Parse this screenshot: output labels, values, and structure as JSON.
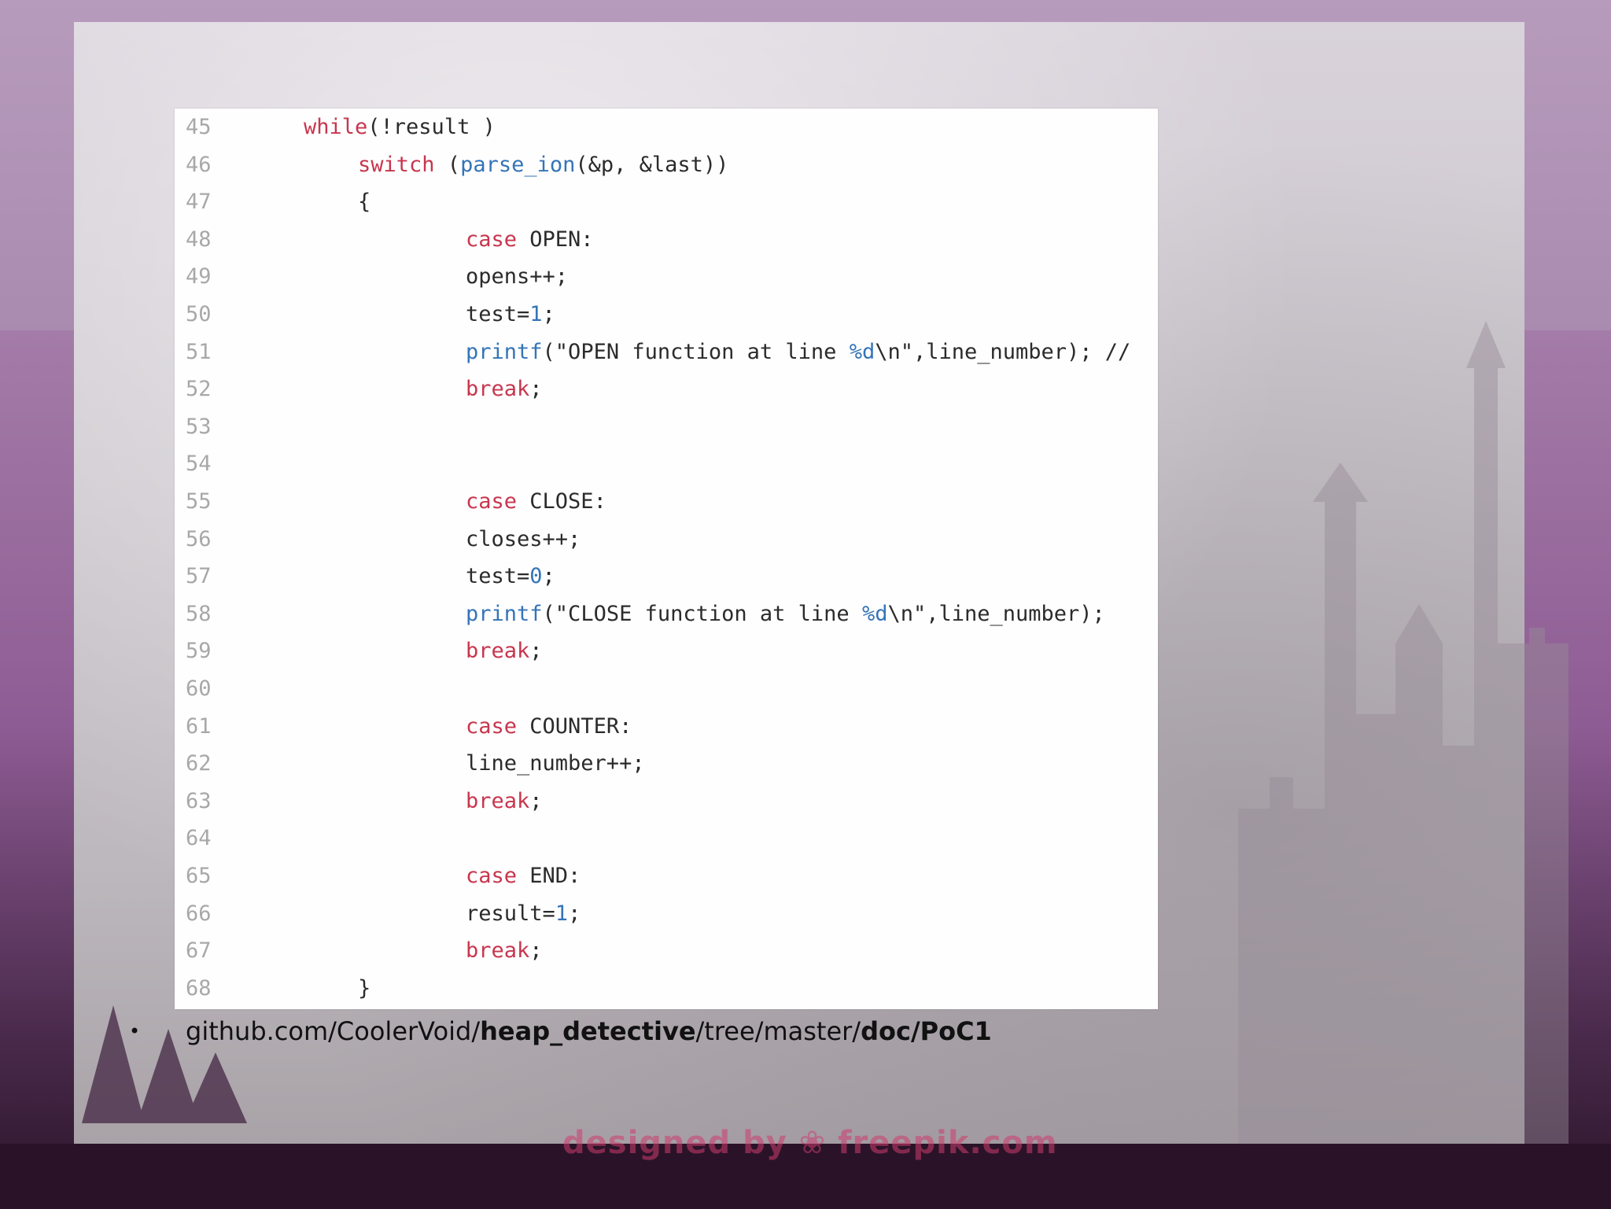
{
  "code": {
    "lines": [
      {
        "n": "45",
        "indent": 0,
        "parts": [
          {
            "t": "while",
            "c": "kw"
          },
          {
            "t": "(!result )",
            "c": ""
          }
        ]
      },
      {
        "n": "46",
        "indent": 1,
        "parts": [
          {
            "t": "switch",
            "c": "kw"
          },
          {
            "t": " (",
            "c": ""
          },
          {
            "t": "parse_ion",
            "c": "fn"
          },
          {
            "t": "(&p, &last))",
            "c": ""
          }
        ]
      },
      {
        "n": "47",
        "indent": 1,
        "parts": [
          {
            "t": "{",
            "c": ""
          }
        ]
      },
      {
        "n": "48",
        "indent": 2,
        "parts": [
          {
            "t": "case",
            "c": "kw"
          },
          {
            "t": " OPEN:",
            "c": ""
          }
        ]
      },
      {
        "n": "49",
        "indent": 2,
        "parts": [
          {
            "t": "opens++;",
            "c": ""
          }
        ]
      },
      {
        "n": "50",
        "indent": 2,
        "parts": [
          {
            "t": "test=",
            "c": ""
          },
          {
            "t": "1",
            "c": "num"
          },
          {
            "t": ";",
            "c": ""
          }
        ]
      },
      {
        "n": "51",
        "indent": 2,
        "parts": [
          {
            "t": "printf",
            "c": "fn"
          },
          {
            "t": "(\"OPEN function at line ",
            "c": ""
          },
          {
            "t": "%d",
            "c": "num"
          },
          {
            "t": "\\n\",line_number); //",
            "c": ""
          }
        ]
      },
      {
        "n": "52",
        "indent": 2,
        "parts": [
          {
            "t": "break",
            "c": "kw"
          },
          {
            "t": ";",
            "c": ""
          }
        ]
      },
      {
        "n": "53",
        "indent": 2,
        "parts": []
      },
      {
        "n": "54",
        "indent": 2,
        "parts": []
      },
      {
        "n": "55",
        "indent": 2,
        "parts": [
          {
            "t": "case",
            "c": "kw"
          },
          {
            "t": " CLOSE:",
            "c": ""
          }
        ]
      },
      {
        "n": "56",
        "indent": 2,
        "parts": [
          {
            "t": "closes++;",
            "c": ""
          }
        ]
      },
      {
        "n": "57",
        "indent": 2,
        "parts": [
          {
            "t": "test=",
            "c": ""
          },
          {
            "t": "0",
            "c": "num"
          },
          {
            "t": ";",
            "c": ""
          }
        ]
      },
      {
        "n": "58",
        "indent": 2,
        "parts": [
          {
            "t": "printf",
            "c": "fn"
          },
          {
            "t": "(\"CLOSE function at line ",
            "c": ""
          },
          {
            "t": "%d",
            "c": "num"
          },
          {
            "t": "\\n\",line_number);",
            "c": ""
          }
        ]
      },
      {
        "n": "59",
        "indent": 2,
        "parts": [
          {
            "t": "break",
            "c": "kw"
          },
          {
            "t": ";",
            "c": ""
          }
        ]
      },
      {
        "n": "60",
        "indent": 2,
        "parts": []
      },
      {
        "n": "61",
        "indent": 2,
        "parts": [
          {
            "t": "case",
            "c": "kw"
          },
          {
            "t": " COUNTER:",
            "c": ""
          }
        ]
      },
      {
        "n": "62",
        "indent": 2,
        "parts": [
          {
            "t": "line_number++;",
            "c": ""
          }
        ]
      },
      {
        "n": "63",
        "indent": 2,
        "parts": [
          {
            "t": "break",
            "c": "kw"
          },
          {
            "t": ";",
            "c": ""
          }
        ]
      },
      {
        "n": "64",
        "indent": 2,
        "parts": []
      },
      {
        "n": "65",
        "indent": 2,
        "parts": [
          {
            "t": "case",
            "c": "kw"
          },
          {
            "t": " END:",
            "c": ""
          }
        ]
      },
      {
        "n": "66",
        "indent": 2,
        "parts": [
          {
            "t": "result=",
            "c": ""
          },
          {
            "t": "1",
            "c": "num"
          },
          {
            "t": ";",
            "c": ""
          }
        ]
      },
      {
        "n": "67",
        "indent": 2,
        "parts": [
          {
            "t": "break",
            "c": "kw"
          },
          {
            "t": ";",
            "c": ""
          }
        ]
      },
      {
        "n": "68",
        "indent": 1,
        "parts": [
          {
            "t": "}",
            "c": ""
          }
        ]
      }
    ]
  },
  "bullet": {
    "dot": "•",
    "segments": [
      {
        "t": "github.com/CoolerVoid/",
        "bold": false
      },
      {
        "t": "heap_detective",
        "bold": true
      },
      {
        "t": "/tree/master/",
        "bold": false
      },
      {
        "t": "doc/PoC1",
        "bold": true
      }
    ]
  },
  "watermark": "designed by ❀ freepik.com",
  "colors": {
    "keyword": "#c8364e",
    "function": "#3474b8",
    "number": "#3474b8",
    "line_number": "#a8a8a8"
  }
}
